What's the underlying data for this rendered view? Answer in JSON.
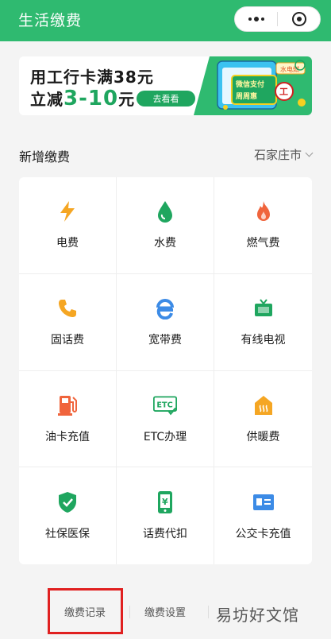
{
  "header": {
    "title": "生活缴费",
    "accent": "#2fba70"
  },
  "banner": {
    "line1": "用工行卡满38元",
    "line2_prefix": "立减",
    "line2_highlight": "3-10",
    "line2_suffix": "元",
    "button": "去看看",
    "tag_water": "水电燃",
    "sign_line1": "微信支付",
    "sign_line2": "周周惠",
    "bank_mark": "工"
  },
  "section": {
    "title": "新增缴费",
    "city": "石家庄市"
  },
  "services": [
    {
      "label": "电费",
      "icon": "lightning-icon",
      "color": "#f5a623"
    },
    {
      "label": "水费",
      "icon": "water-drop-icon",
      "color": "#1fa65f"
    },
    {
      "label": "燃气费",
      "icon": "flame-icon",
      "color": "#f0643c"
    },
    {
      "label": "固话费",
      "icon": "phone-icon",
      "color": "#f5a623"
    },
    {
      "label": "宽带费",
      "icon": "broadband-icon",
      "color": "#3c8be6"
    },
    {
      "label": "有线电视",
      "icon": "tv-icon",
      "color": "#1fa65f"
    },
    {
      "label": "油卡充值",
      "icon": "fuel-pump-icon",
      "color": "#f0643c"
    },
    {
      "label": "ETC办理",
      "icon": "etc-icon",
      "color": "#1fa65f",
      "icon_text": "ETC"
    },
    {
      "label": "供暖费",
      "icon": "heating-icon",
      "color": "#f5a623"
    },
    {
      "label": "社保医保",
      "icon": "shield-icon",
      "color": "#1fa65f"
    },
    {
      "label": "话费代扣",
      "icon": "mobile-pay-icon",
      "color": "#1fa65f",
      "icon_text": "¥"
    },
    {
      "label": "公交卡充值",
      "icon": "bus-card-icon",
      "color": "#3c8be6"
    }
  ],
  "footer": {
    "record": "缴费记录",
    "settings": "缴费设置",
    "watermark": "易坊好文馆",
    "highlight_color": "#e02020"
  }
}
